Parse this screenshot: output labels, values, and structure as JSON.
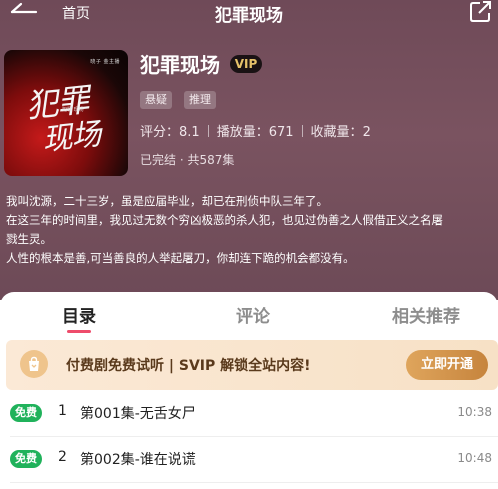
{
  "nav": {
    "back_label": "首页",
    "title": "犯罪现场"
  },
  "book": {
    "cover_title_line1": "犯罪",
    "cover_title_line2": "现场",
    "cover_author": "晓子 金主播",
    "cover_sub": "犯罪 现场",
    "title": "犯罪现场",
    "vip": "VIP",
    "tags": [
      "悬疑",
      "推理"
    ],
    "rating_label": "评分：",
    "rating": "8.1",
    "plays_label": "播放量：",
    "plays": "671",
    "favs_label": "收藏量：",
    "favs": "2",
    "status": "已完结 · 共587集"
  },
  "description": [
    "我叫沈源，二十三岁，虽是应届毕业，却已在刑侦中队三年了。",
    "在这三年的时间里，我见过无数个穷凶极恶的杀人犯，也见过伪善之人假借正义之名屠",
    "戮生灵。",
    "人性的根本是善,可当善良的人举起屠刀，你却连下跪的机会都没有。"
  ],
  "tabs": [
    {
      "label": "目录",
      "active": true
    },
    {
      "label": "评论",
      "active": false
    },
    {
      "label": "相关推荐",
      "active": false
    }
  ],
  "banner": {
    "text": "付费剧免费试听 | SVIP 解锁全站内容!",
    "button": "立即开通"
  },
  "episodes": [
    {
      "badge": "免费",
      "index": "1",
      "name": "第001集-无舌女尸",
      "duration": "10:38"
    },
    {
      "badge": "免费",
      "index": "2",
      "name": "第002集-谁在说谎",
      "duration": "10:48"
    }
  ],
  "colors": {
    "hero_bg": "#74505d",
    "accent": "#ee4c6b",
    "free_badge": "#20b25b",
    "vip_gold": "#e6c26a",
    "banner_btn": "#d3954c"
  }
}
